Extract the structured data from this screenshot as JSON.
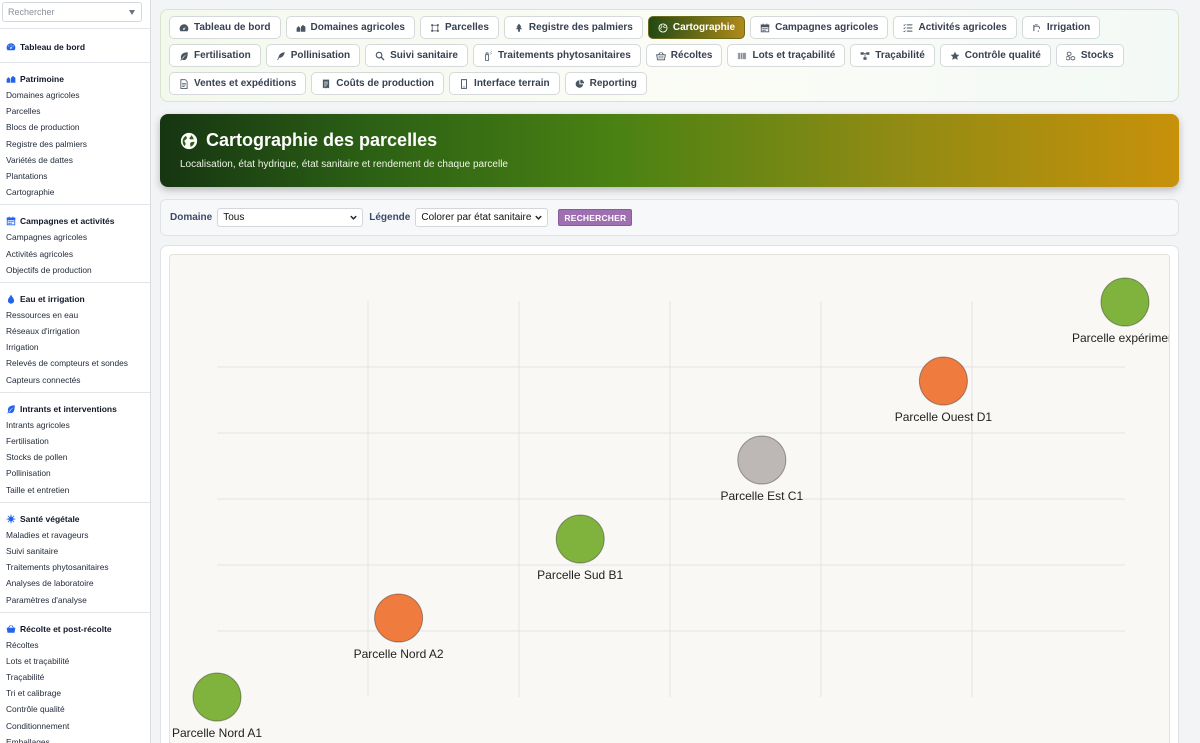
{
  "sidebar": {
    "search_placeholder": "Rechercher",
    "dashboard": "Tableau de bord",
    "groups": [
      {
        "title": "Patrimoine",
        "icon": "farm-icon",
        "items": [
          "Domaines agricoles",
          "Parcelles",
          "Blocs de production",
          "Registre des palmiers",
          "Variétés de dattes",
          "Plantations",
          "Cartographie"
        ]
      },
      {
        "title": "Campagnes et activités",
        "icon": "calendar-icon",
        "items": [
          "Campagnes agricoles",
          "Activités agricoles",
          "Objectifs de production"
        ]
      },
      {
        "title": "Eau et irrigation",
        "icon": "water-drop-icon",
        "items": [
          "Ressources en eau",
          "Réseaux d'irrigation",
          "Irrigation",
          "Relevés de compteurs et sondes",
          "Capteurs connectés"
        ]
      },
      {
        "title": "Intrants et interventions",
        "icon": "leaf-icon",
        "items": [
          "Intrants agricoles",
          "Fertilisation",
          "Stocks de pollen",
          "Pollinisation",
          "Taille et entretien"
        ]
      },
      {
        "title": "Santé végétale",
        "icon": "virus-icon",
        "items": [
          "Maladies et ravageurs",
          "Suivi sanitaire",
          "Traitements phytosanitaires",
          "Analyses de laboratoire",
          "Paramètres d'analyse"
        ]
      },
      {
        "title": "Récolte et post-récolte",
        "icon": "harvest-icon",
        "items": [
          "Récoltes",
          "Lots et traçabilité",
          "Traçabilité",
          "Tri et calibrage",
          "Contrôle qualité",
          "Conditionnement",
          "Emballages"
        ]
      }
    ]
  },
  "tabs": [
    {
      "label": "Tableau de bord",
      "icon": "gauge-icon",
      "active": false
    },
    {
      "label": "Domaines agricoles",
      "icon": "farm-icon",
      "active": false
    },
    {
      "label": "Parcelles",
      "icon": "vector-square-icon",
      "active": false
    },
    {
      "label": "Registre des palmiers",
      "icon": "tree-icon",
      "active": false
    },
    {
      "label": "Cartographie",
      "icon": "globe-icon",
      "active": true
    },
    {
      "label": "Campagnes agricoles",
      "icon": "calendar-icon",
      "active": false
    },
    {
      "label": "Activités agricoles",
      "icon": "list-check-icon",
      "active": false
    },
    {
      "label": "Irrigation",
      "icon": "faucet-icon",
      "active": false
    },
    {
      "label": "Fertilisation",
      "icon": "leaf-icon",
      "active": false
    },
    {
      "label": "Pollinisation",
      "icon": "feather-icon",
      "active": false
    },
    {
      "label": "Suivi sanitaire",
      "icon": "magnifier-icon",
      "active": false
    },
    {
      "label": "Traitements phytosanitaires",
      "icon": "spray-icon",
      "active": false
    },
    {
      "label": "Récoltes",
      "icon": "basket-icon",
      "active": false
    },
    {
      "label": "Lots et traçabilité",
      "icon": "barcode-icon",
      "active": false
    },
    {
      "label": "Traçabilité",
      "icon": "diagram-icon",
      "active": false
    },
    {
      "label": "Contrôle qualité",
      "icon": "star-icon",
      "active": false
    },
    {
      "label": "Stocks",
      "icon": "cubes-icon",
      "active": false
    },
    {
      "label": "Ventes et expéditions",
      "icon": "invoice-icon",
      "active": false
    },
    {
      "label": "Coûts de production",
      "icon": "receipt-icon",
      "active": false
    },
    {
      "label": "Interface terrain",
      "icon": "mobile-icon",
      "active": false
    },
    {
      "label": "Reporting",
      "icon": "pie-chart-icon",
      "active": false
    }
  ],
  "banner": {
    "title": "Cartographie des parcelles",
    "subtitle": "Localisation, état hydrique, état sanitaire et rendement de chaque parcelle"
  },
  "filters": {
    "domain_label": "Domaine",
    "domain_value": "Tous",
    "legend_label": "Légende",
    "legend_value": "Colorer par état sanitaire",
    "search_button": "RECHERCHER"
  },
  "colors": {
    "healthy": "#7fb33d",
    "alert": "#ef7b3e",
    "unknown": "#bdb8b5",
    "accent_button": "#9f6fb1"
  },
  "parcels": [
    {
      "name": "Parcelle Nord A1",
      "status": "healthy",
      "x": 0,
      "y": 0
    },
    {
      "name": "Parcelle Nord A2",
      "status": "alert",
      "x": 1,
      "y": 1
    },
    {
      "name": "Parcelle Sud B1",
      "status": "healthy",
      "x": 2,
      "y": 2
    },
    {
      "name": "Parcelle Est C1",
      "status": "unknown",
      "x": 3,
      "y": 3
    },
    {
      "name": "Parcelle Ouest D1",
      "status": "alert",
      "x": 4,
      "y": 4
    },
    {
      "name": "Parcelle expérimen.",
      "status": "healthy",
      "x": 5,
      "y": 5
    }
  ]
}
